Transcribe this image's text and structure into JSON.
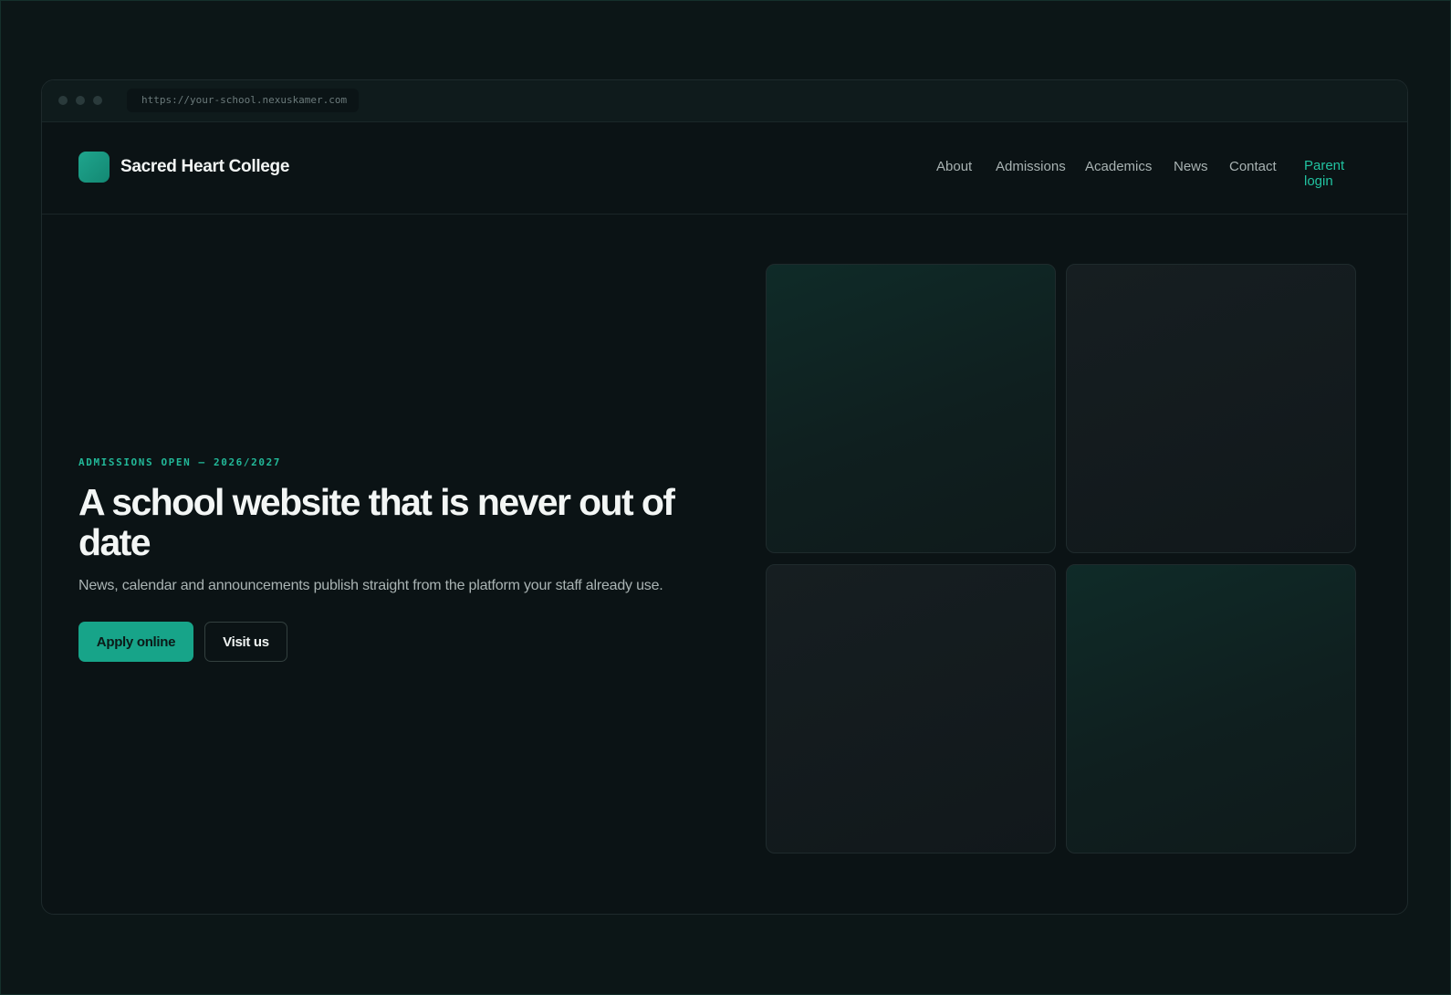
{
  "browser": {
    "url": "https://your-school.nexuskamer.com"
  },
  "header": {
    "brand_name": "Sacred Heart College",
    "nav": {
      "about": "About",
      "admissions": "Admissions",
      "academics": "Academics",
      "news": "News",
      "contact": "Contact",
      "parent_login": "Parent login"
    }
  },
  "hero": {
    "eyebrow": "ADMISSIONS OPEN — 2026/2027",
    "headline": "A school website that is never out of date",
    "subtext": "News, calendar and announcements publish straight from the platform your staff already use.",
    "primary_cta": "Apply online",
    "secondary_cta": "Visit us"
  },
  "colors": {
    "accent": "#17a489",
    "accent_text": "#21c2a0",
    "background": "#0b1315"
  }
}
